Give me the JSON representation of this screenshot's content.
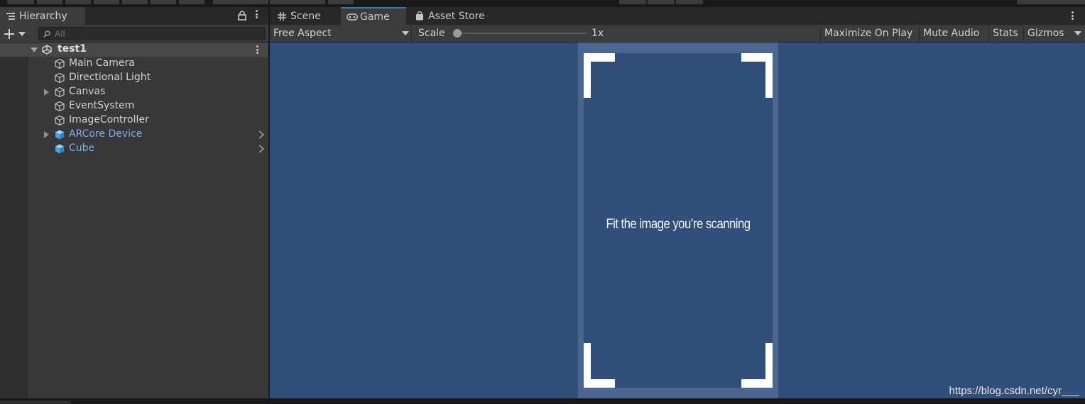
{
  "hierarchy": {
    "tab_label": "Hierarchy",
    "search_placeholder": "All",
    "scene_name": "test1",
    "items": [
      {
        "label": "Main Camera",
        "expandable": false,
        "prefab": false
      },
      {
        "label": "Directional Light",
        "expandable": false,
        "prefab": false
      },
      {
        "label": "Canvas",
        "expandable": true,
        "prefab": false
      },
      {
        "label": "EventSystem",
        "expandable": false,
        "prefab": false
      },
      {
        "label": "ImageController",
        "expandable": false,
        "prefab": false
      },
      {
        "label": "ARCore Device",
        "expandable": true,
        "prefab": true
      },
      {
        "label": "Cube",
        "expandable": false,
        "prefab": true
      }
    ]
  },
  "game_panel": {
    "tabs": [
      {
        "label": "Scene",
        "icon": "grid-icon",
        "active": false
      },
      {
        "label": "Game",
        "icon": "gamepad-icon",
        "active": true
      },
      {
        "label": "Asset Store",
        "icon": "shopping-bag-icon",
        "active": false
      }
    ],
    "toolbar": {
      "aspect": "Free Aspect",
      "scale_label": "Scale",
      "scale_value": "1x",
      "maximize_on_play": "Maximize On Play",
      "mute_audio": "Mute Audio",
      "stats": "Stats",
      "gizmos": "Gizmos"
    },
    "viewport": {
      "prompt": "Fit the image you’re scanning",
      "watermark": "https://blog.csdn.net/cyr___"
    }
  },
  "colors": {
    "viewport_bg": "#324f7c",
    "prefab_text": "#7cadf0",
    "active_tab_accent": "#3a79bb"
  }
}
